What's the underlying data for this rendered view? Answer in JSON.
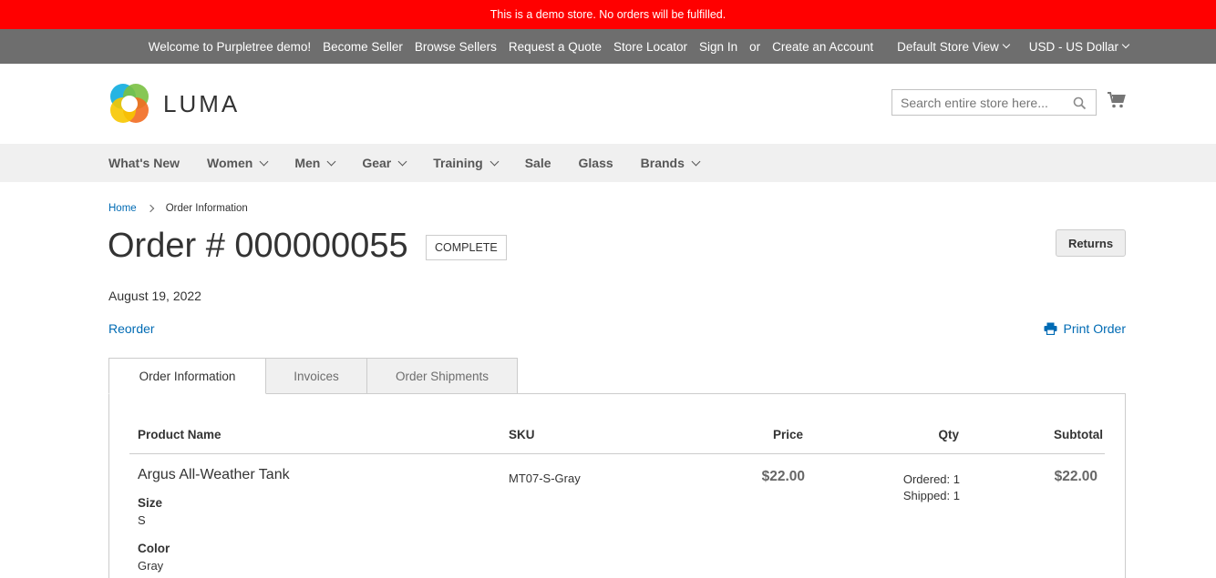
{
  "demo_notice": "This is a demo store. No orders will be fulfilled.",
  "top_links": {
    "welcome": "Welcome to Purpletree demo!",
    "become_seller": "Become Seller",
    "browse_sellers": "Browse Sellers",
    "request_quote": "Request a Quote",
    "store_locator": "Store Locator",
    "sign_in": "Sign In",
    "or": "or",
    "create_account": "Create an Account",
    "store_view": "Default Store View",
    "currency": "USD - US Dollar"
  },
  "logo": {
    "text": "LUMA"
  },
  "search": {
    "placeholder": "Search entire store here..."
  },
  "nav": [
    "What's New",
    "Women",
    "Men",
    "Gear",
    "Training",
    "Sale",
    "Glass",
    "Brands"
  ],
  "breadcrumbs": {
    "home": "Home",
    "current": "Order Information"
  },
  "order": {
    "title": "Order # 000000055",
    "status": "COMPLETE",
    "returns_label": "Returns",
    "date": "August 19, 2022",
    "reorder_label": "Reorder",
    "print_label": "Print Order"
  },
  "tabs": [
    "Order Information",
    "Invoices",
    "Order Shipments"
  ],
  "table": {
    "headers": {
      "product": "Product Name",
      "sku": "SKU",
      "price": "Price",
      "qty": "Qty",
      "subtotal": "Subtotal"
    },
    "rows": [
      {
        "name": "Argus All-Weather Tank",
        "options": [
          {
            "label": "Size",
            "value": "S"
          },
          {
            "label": "Color",
            "value": "Gray"
          }
        ],
        "sku": "MT07-S-Gray",
        "price": "$22.00",
        "qty_ordered": "Ordered: 1",
        "qty_shipped": "Shipped: 1",
        "subtotal": "$22.00"
      }
    ]
  },
  "colors": {
    "demo_bar": "#ff0000",
    "top_bar": "#6e6e6e",
    "link": "#006bb4",
    "nav_bg": "#f0f0f0"
  }
}
